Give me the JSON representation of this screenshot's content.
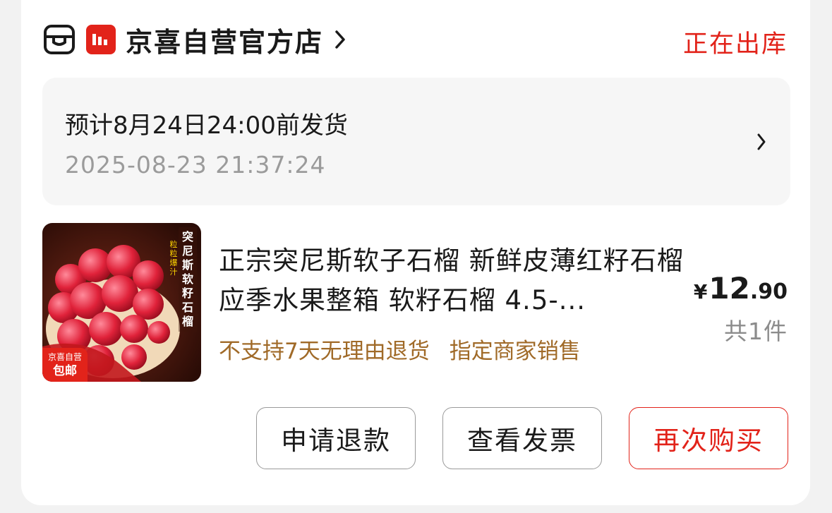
{
  "store": {
    "name": "京喜自营官方店",
    "icon": "jd-store-icon",
    "badge_icon": "jingxi-logo"
  },
  "order_status": "正在出库",
  "delivery": {
    "title": "预计8月24日24:00前发货",
    "timestamp": "2025-08-23 21:37:24"
  },
  "product": {
    "title": "正宗突尼斯软子石榴 新鲜皮薄红籽石榴应季水果整箱 软籽石榴 4.5-...",
    "thumb": {
      "side_text": "突尼斯软籽石榴",
      "tag_text": "粒粒爆汁",
      "badge_top": "京喜自营",
      "badge_bottom": "包邮"
    },
    "tags": [
      "不支持7天无理由退货",
      "指定商家销售"
    ],
    "price": {
      "currency": "¥",
      "integer": "12",
      "decimal": ".90"
    },
    "quantity": "共1件"
  },
  "actions": {
    "refund": "申请退款",
    "invoice": "查看发票",
    "rebuy": "再次购买"
  },
  "colors": {
    "accent": "#e2231a",
    "tag": "#a06a28",
    "muted": "#9b9b9b"
  }
}
